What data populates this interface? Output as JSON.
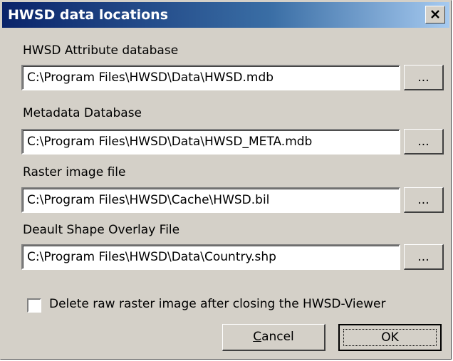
{
  "window": {
    "title": "HWSD data locations",
    "close_icon": "close-icon"
  },
  "fields": [
    {
      "label": "HWSD Attribute database",
      "value": "C:\\Program Files\\HWSD\\Data\\HWSD.mdb",
      "browse_label": "..."
    },
    {
      "label": "Metadata Database",
      "value": "C:\\Program Files\\HWSD\\Data\\HWSD_META.mdb",
      "browse_label": "..."
    },
    {
      "label": "Raster image file",
      "value": "C:\\Program Files\\HWSD\\Cache\\HWSD.bil",
      "browse_label": "..."
    },
    {
      "label": "Deault Shape Overlay File",
      "value": "C:\\Program Files\\HWSD\\Data\\Country.shp",
      "browse_label": "..."
    }
  ],
  "delete_raw": {
    "label": "Delete raw raster image after closing the HWSD-Viewer",
    "checked": false
  },
  "buttons": {
    "cancel_mnemonic": "C",
    "cancel_rest": "ancel",
    "ok": "OK"
  },
  "colors": {
    "face": "#d4d0c8",
    "title_start": "#0a246a",
    "title_end": "#a6caf0"
  }
}
